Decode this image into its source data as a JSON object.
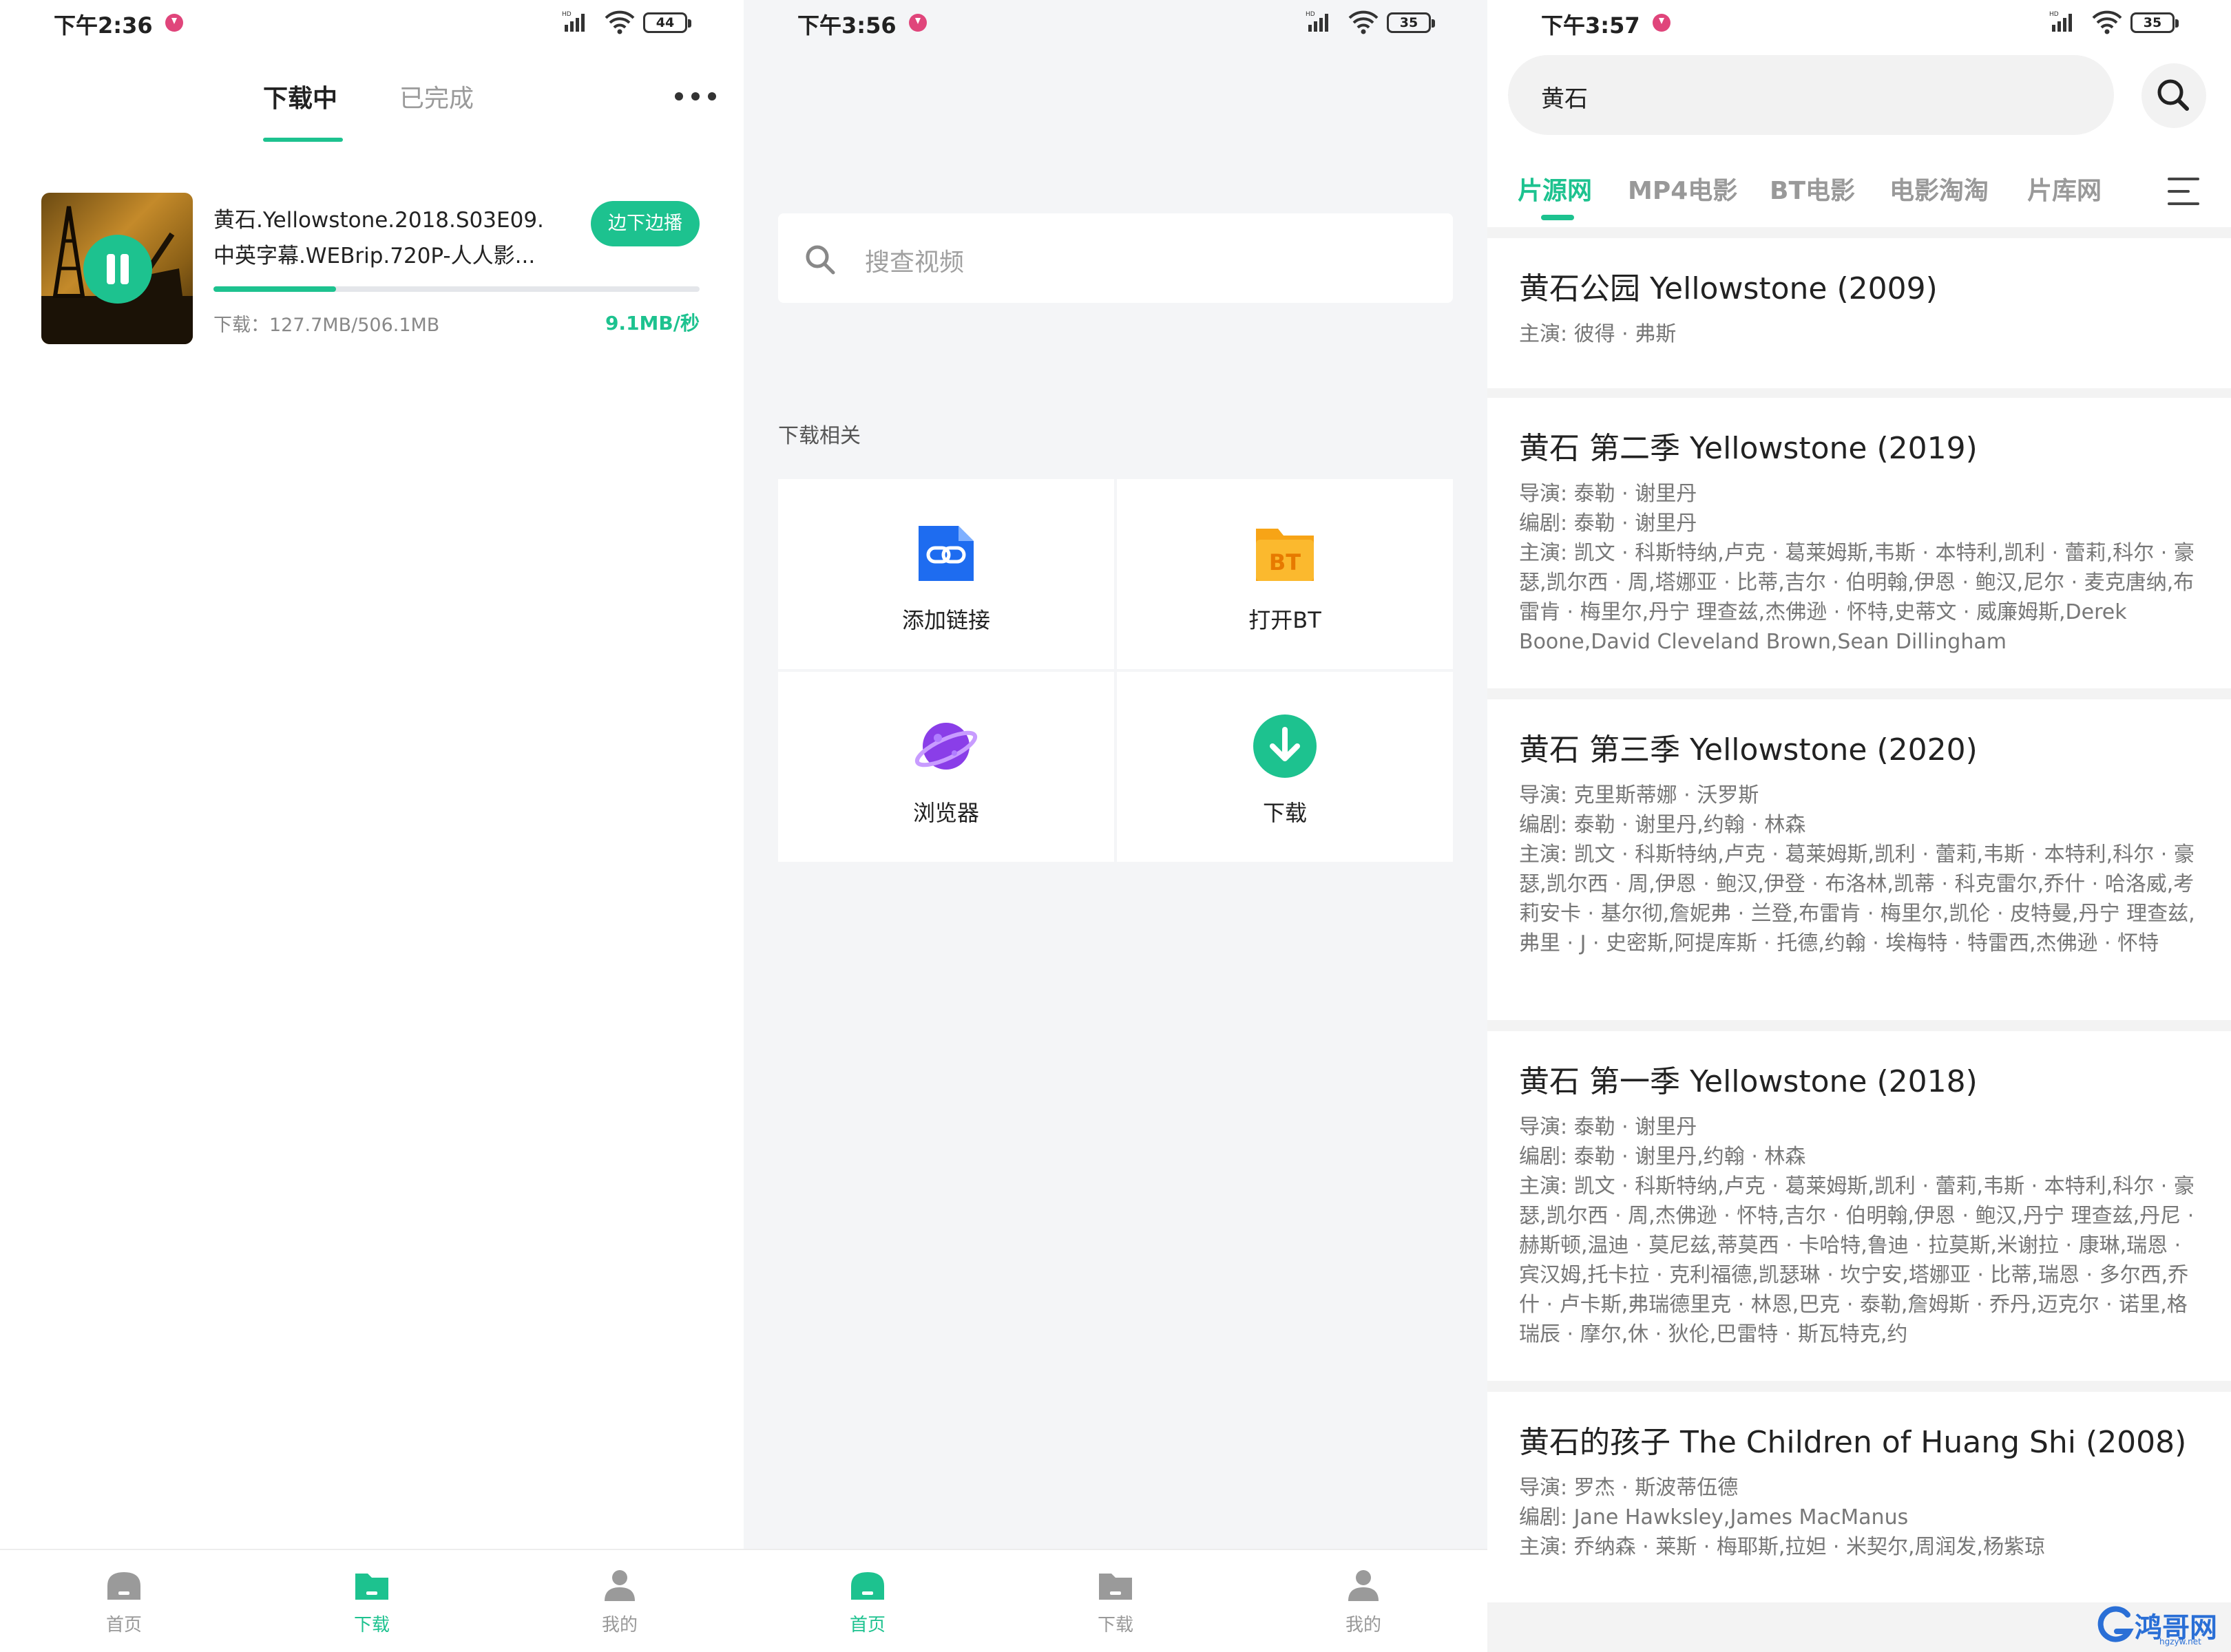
{
  "screen1": {
    "status": {
      "time": "下午2:36",
      "battery": "44"
    },
    "tabs": {
      "downloading": "下载中",
      "completed": "已完成"
    },
    "item": {
      "title_line1": "黄石.Yellowstone.2018.S03E09.",
      "title_line2": "中英字幕.WEBrip.720P-人人影...",
      "play_while_label": "边下边播",
      "size_text": "下载：127.7MB/506.1MB",
      "speed_text": "9.1MB/秒",
      "progress": 0.2523
    },
    "nav": {
      "home": "首页",
      "download": "下载",
      "mine": "我的"
    }
  },
  "screen2": {
    "status": {
      "time": "下午3:56",
      "battery": "35"
    },
    "search_placeholder": "搜查视频",
    "section_title": "下载相关",
    "grid": [
      {
        "label": "添加链接",
        "icon": "link-icon"
      },
      {
        "label": "打开BT",
        "icon": "bt-folder-icon",
        "icon_text": "BT"
      },
      {
        "label": "浏览器",
        "icon": "planet-icon"
      },
      {
        "label": "下载",
        "icon": "download-circle-icon"
      }
    ],
    "nav": {
      "home": "首页",
      "download": "下载",
      "mine": "我的"
    }
  },
  "screen3": {
    "status": {
      "time": "下午3:57",
      "battery": "35"
    },
    "query": "黄石",
    "sources": [
      "片源网",
      "MP4电影",
      "BT电影",
      "电影淘淘",
      "片库网"
    ],
    "results": [
      {
        "title": "黄石公园 Yellowstone (2009)",
        "lines": [
          "主演: 彼得 · 弗斯"
        ]
      },
      {
        "title": "黄石 第二季 Yellowstone (2019)",
        "lines": [
          "导演: 泰勒 · 谢里丹",
          "编剧: 泰勒 · 谢里丹",
          "主演: 凯文 · 科斯特纳,卢克 · 葛莱姆斯,韦斯 · 本特利,凯利 · 蕾莉,科尔 · 豪瑟,凯尔西 · 周,塔娜亚 · 比蒂,吉尔 · 伯明翰,伊恩 · 鲍汉,尼尔 · 麦克唐纳,布雷肯 · 梅里尔,丹宁 理查兹,杰佛逊 · 怀特,史蒂文 · 威廉姆斯,Derek Boone,David Cleveland Brown,Sean Dillingham"
        ]
      },
      {
        "title": "黄石 第三季 Yellowstone (2020)",
        "lines": [
          "导演: 克里斯蒂娜 · 沃罗斯",
          "编剧: 泰勒 · 谢里丹,约翰 · 林森",
          "主演: 凯文 · 科斯特纳,卢克 · 葛莱姆斯,凯利 · 蕾莉,韦斯 · 本特利,科尔 · 豪瑟,凯尔西 · 周,伊恩 · 鲍汉,伊登 · 布洛林,凯蒂 · 科克雷尔,乔什 · 哈洛威,考莉安卡 · 基尔彻,詹妮弗 · 兰登,布雷肯 · 梅里尔,凯伦 · 皮特曼,丹宁 理查兹,弗里 · J · 史密斯,阿提库斯 · 托德,约翰 · 埃梅特 · 特雷西,杰佛逊 · 怀特"
        ]
      },
      {
        "title": "黄石 第一季 Yellowstone (2018)",
        "lines": [
          "导演: 泰勒 · 谢里丹",
          "编剧: 泰勒 · 谢里丹,约翰 · 林森",
          "主演: 凯文 · 科斯特纳,卢克 · 葛莱姆斯,凯利 · 蕾莉,韦斯 · 本特利,科尔 · 豪瑟,凯尔西 · 周,杰佛逊 · 怀特,吉尔 · 伯明翰,伊恩 · 鲍汉,丹宁 理查兹,丹尼 · 赫斯顿,温迪 · 莫尼兹,蒂莫西 · 卡哈特,鲁迪 · 拉莫斯,米谢拉 · 康琳,瑞恩 · 宾汉姆,托卡拉 · 克利福德,凯瑟琳 · 坎宁安,塔娜亚 · 比蒂,瑞恩 · 多尔西,乔什 · 卢卡斯,弗瑞德里克 · 林恩,巴克 · 泰勒,詹姆斯 · 乔丹,迈克尔 · 诺里,格瑞辰 · 摩尔,休 · 狄伦,巴雷特 · 斯瓦特克,约"
        ]
      },
      {
        "title": "黄石的孩子 The Children of Huang Shi (2008)",
        "lines": [
          "导演: 罗杰 · 斯波蒂伍德",
          "编剧: Jane Hawksley,James MacManus",
          "主演: 乔纳森 · 莱斯 · 梅耶斯,拉妲 · 米契尔,周润发,杨紫琼"
        ]
      }
    ],
    "watermark": {
      "text": "鸿哥网",
      "sub": "hgzyw.net"
    }
  },
  "colors": {
    "accent": "#1dc28f",
    "link_blue": "#1e6cf0",
    "bt_orange": "#f7a416",
    "planet_purple": "#8a3ee8",
    "notif": "#e0457b"
  }
}
